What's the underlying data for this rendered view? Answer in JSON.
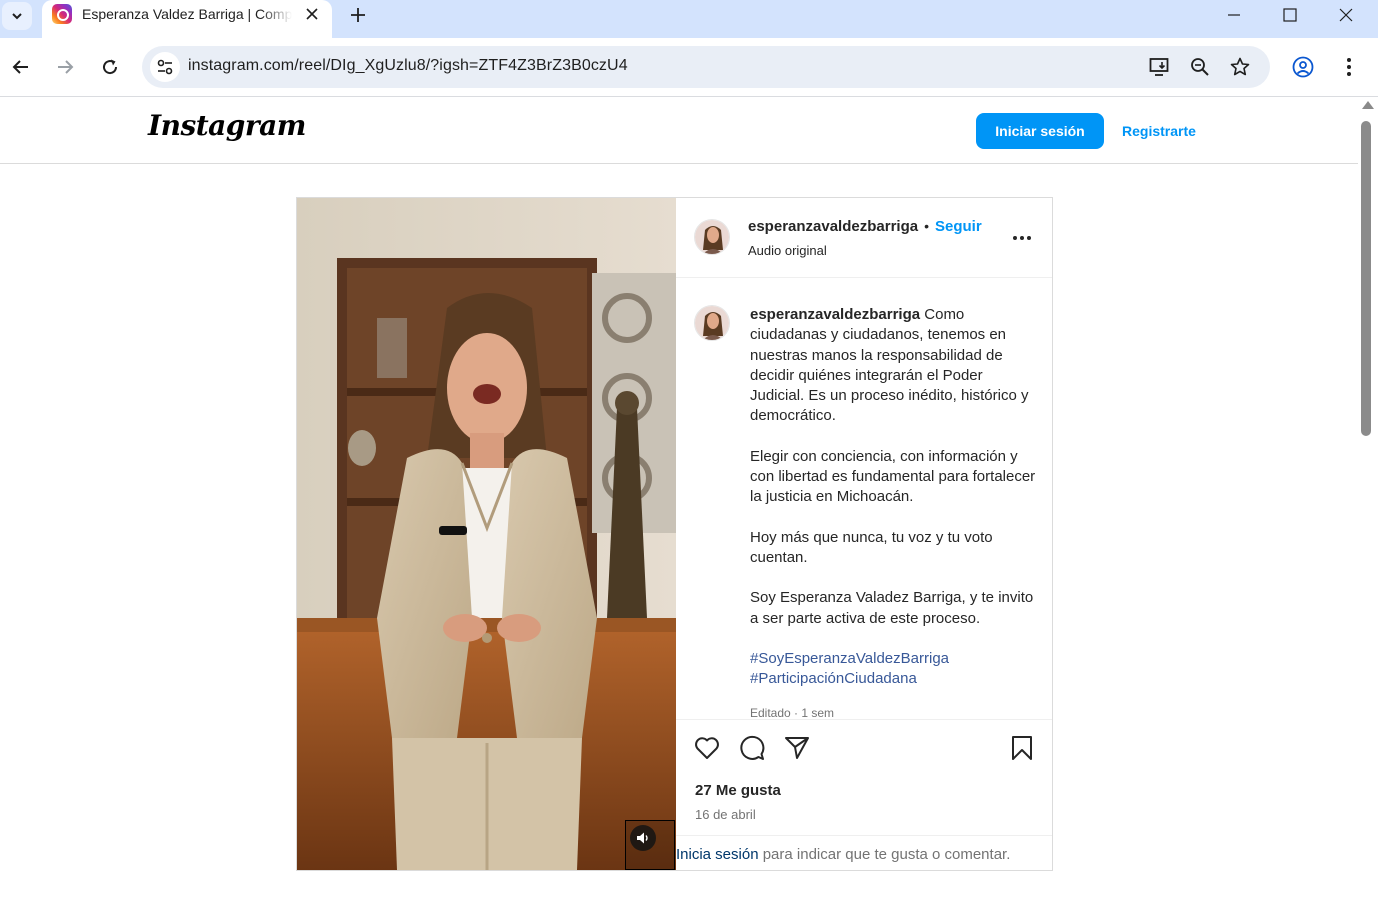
{
  "browser": {
    "tab_title": "Esperanza Valdez Barriga | Comp",
    "url": "instagram.com/reel/DIg_XgUzlu8/?igsh=ZTF4Z3BrZ3B0czU4"
  },
  "header": {
    "logo_text": "Instagram",
    "login_button": "Iniciar sesión",
    "signup_link": "Registrarte"
  },
  "post": {
    "username": "esperanzavaldezbarriga",
    "separator": "•",
    "follow": "Seguir",
    "audio": "Audio original",
    "caption": {
      "username": "esperanzavaldezbarriga",
      "p1": "Como ciudadanas y ciudadanos, tenemos en nuestras manos la responsabilidad de decidir quiénes integrarán el Poder Judicial. Es un proceso inédito, histórico y democrático.",
      "p2": "Elegir con conciencia, con información y con libertad es fundamental para fortalecer la justicia en Michoacán.",
      "p3": "Hoy más que nunca, tu voz y tu voto cuentan.",
      "p4": "Soy Esperanza Valadez Barriga, y te invito a ser parte activa de este proceso.",
      "hashtags": [
        "#SoyEsperanzaValdezBarriga",
        "#ParticipaciónCiudadana"
      ]
    },
    "meta": "Editado · 1 sem",
    "likes": "27 Me gusta",
    "date": "16 de abril",
    "login_prompt_link": "Inicia sesión",
    "login_prompt_rest": " para indicar que te gusta o comentar."
  },
  "colors": {
    "accent": "#0095f6",
    "hashtag": "#385898",
    "tabbar": "#d3e3fd"
  }
}
